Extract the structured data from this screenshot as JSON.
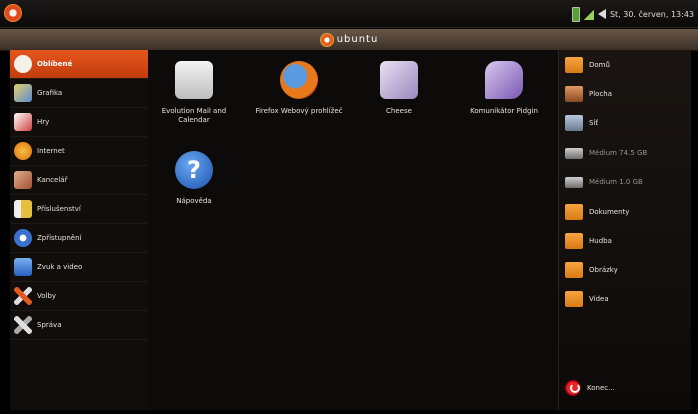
{
  "topbar": {
    "clock": "St, 30. červen, 13:43",
    "icons": [
      "ubuntu-logo-icon",
      "battery-icon",
      "signal-icon",
      "volume-icon"
    ]
  },
  "brand": {
    "text": "ubuntu"
  },
  "categories": [
    {
      "label": "Oblíbené",
      "icon": "heart-icon",
      "color": "#f08a2a",
      "active": true
    },
    {
      "label": "Grafika",
      "icon": "graphics-icon",
      "color": "#5a8ad0"
    },
    {
      "label": "Hry",
      "icon": "games-icon",
      "color": "#d04040"
    },
    {
      "label": "Internet",
      "icon": "globe-icon",
      "color": "#f0a020"
    },
    {
      "label": "Kancelář",
      "icon": "office-icon",
      "color": "#c07050"
    },
    {
      "label": "Příslušenství",
      "icon": "accessories-icon",
      "color": "#e8d070"
    },
    {
      "label": "Zpřístupnění",
      "icon": "accessibility-icon",
      "color": "#3a70d0"
    },
    {
      "label": "Zvuk a video",
      "icon": "multimedia-icon",
      "color": "#4a8ad8"
    },
    {
      "label": "Volby",
      "icon": "preferences-icon",
      "color": "#e05a20"
    },
    {
      "label": "Správa",
      "icon": "administration-icon",
      "color": "#d0d0d0"
    }
  ],
  "apps": [
    {
      "label": "Evolution Mail and Calendar",
      "icon": "mail-icon",
      "color": "#dcdcdc"
    },
    {
      "label": "Firefox Webový prohlížeč",
      "icon": "firefox-icon",
      "color": "#e8781a"
    },
    {
      "label": "Cheese",
      "icon": "cheese-icon",
      "color": "#b8a8d8"
    },
    {
      "label": "Komunikátor Pidgin",
      "icon": "pidgin-icon",
      "color": "#a088c8"
    },
    {
      "label": "Nápověda",
      "icon": "help-icon",
      "color": "#2a6ad0"
    }
  ],
  "places": [
    {
      "label": "Domů",
      "icon": "home-folder-icon",
      "type": "folder"
    },
    {
      "label": "Plocha",
      "icon": "desktop-icon",
      "type": "folder"
    },
    {
      "label": "Síť",
      "icon": "network-icon",
      "type": "net"
    },
    {
      "label": "Médium 74.5 GB",
      "icon": "drive-icon",
      "type": "drive",
      "dim": true
    },
    {
      "label": "Médium 1.0 GB",
      "icon": "drive-icon",
      "type": "drive",
      "dim": true
    },
    {
      "label": "Dokumenty",
      "icon": "folder-icon",
      "type": "folder"
    },
    {
      "label": "Hudba",
      "icon": "folder-icon",
      "type": "folder"
    },
    {
      "label": "Obrázky",
      "icon": "folder-icon",
      "type": "folder"
    },
    {
      "label": "Videa",
      "icon": "folder-icon",
      "type": "folder"
    }
  ],
  "quit": {
    "label": "Konec...",
    "icon": "shutdown-icon"
  }
}
